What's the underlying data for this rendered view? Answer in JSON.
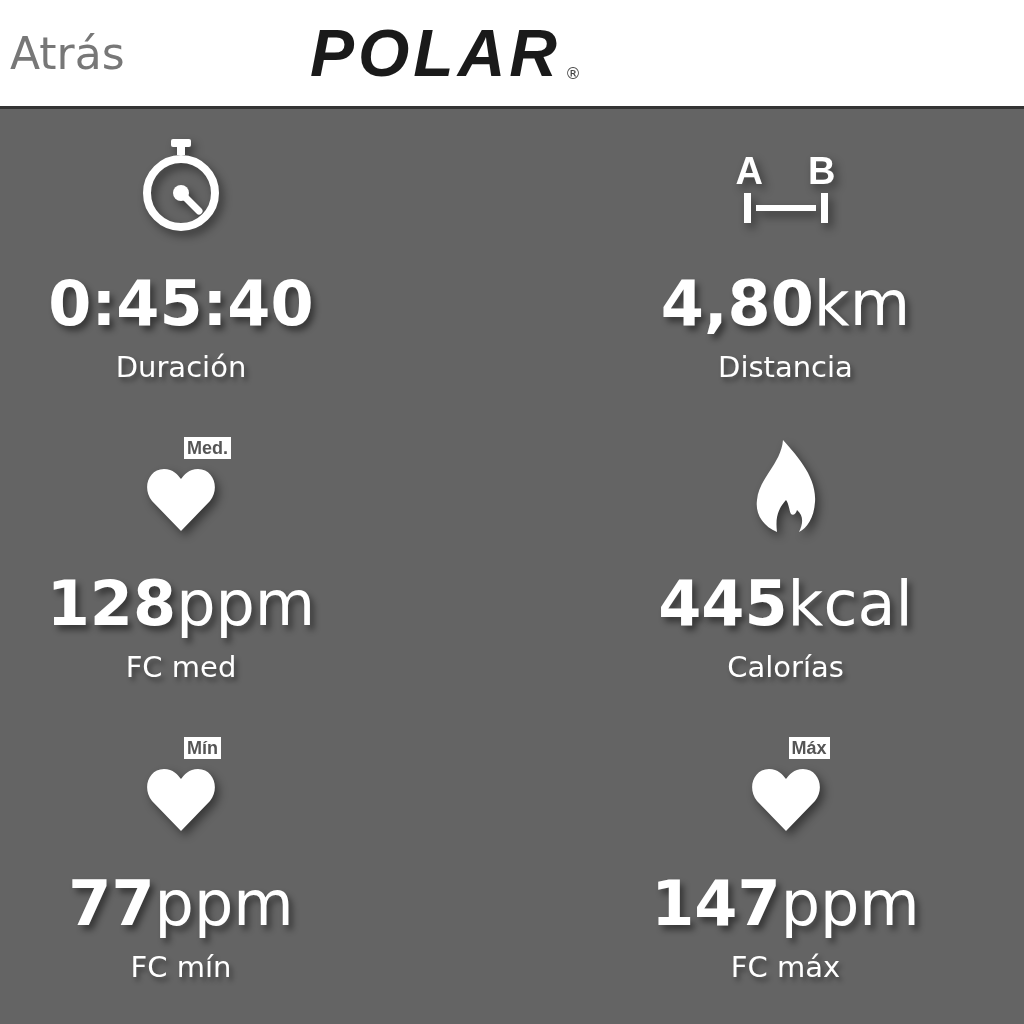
{
  "header": {
    "back": "Atrás",
    "logo": "POLAR",
    "logo_mark": "®"
  },
  "distance_icon": {
    "letters": [
      "A",
      "B"
    ]
  },
  "stats": [
    {
      "kind": "duration",
      "value": "0:45:40",
      "label": "Duración"
    },
    {
      "kind": "distance",
      "value": "4,80",
      "unit": "km",
      "label": "Distancia"
    },
    {
      "kind": "heart",
      "badge": "Med.",
      "value": "128",
      "unit": "ppm",
      "label": "FC med"
    },
    {
      "kind": "calories",
      "value": "445",
      "unit": "kcal",
      "label": "Calorías"
    },
    {
      "kind": "heart",
      "badge": "Mín",
      "value": "77",
      "unit": "ppm",
      "label": "FC mín"
    },
    {
      "kind": "heart",
      "badge": "Máx",
      "value": "147",
      "unit": "ppm",
      "label": "FC máx"
    }
  ]
}
